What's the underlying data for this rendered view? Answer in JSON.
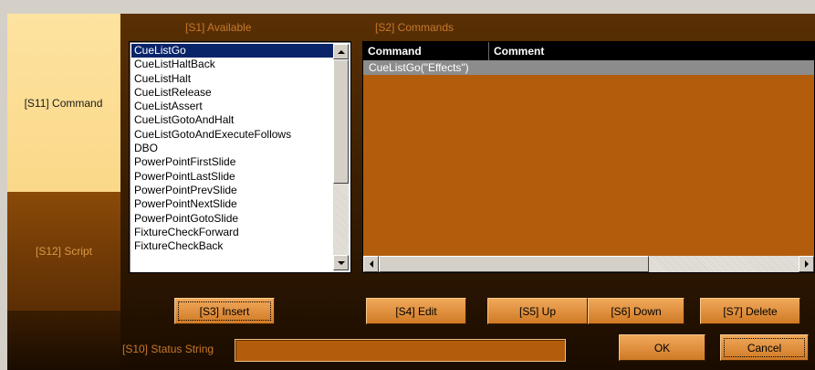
{
  "tabs": {
    "command": "[S11] Command",
    "script": "[S12] Script"
  },
  "labels": {
    "available": "[S1] Available",
    "commands": "[S2] Commands",
    "status": "[S10] Status String"
  },
  "available_list": {
    "selected_index": 0,
    "items": [
      "CueListGo",
      "CueListHaltBack",
      "CueListHalt",
      "CueListRelease",
      "CueListAssert",
      "CueListGotoAndHalt",
      "CueListGotoAndExecuteFollows",
      "DBO",
      "PowerPointFirstSlide",
      "PowerPointLastSlide",
      "PowerPointPrevSlide",
      "PowerPointNextSlide",
      "PowerPointGotoSlide",
      "FixtureCheckForward",
      "FixtureCheckBack"
    ]
  },
  "commands_grid": {
    "columns": [
      "Command",
      "Comment"
    ],
    "rows": [
      {
        "command": "CueListGo(\"Effects\")",
        "comment": ""
      }
    ]
  },
  "buttons": {
    "insert": "[S3] Insert",
    "edit": "[S4] Edit",
    "up": "[S5] Up",
    "down": "[S6] Down",
    "delete": "[S7] Delete",
    "ok": "OK",
    "cancel": "Cancel"
  },
  "status_string": "",
  "colors": {
    "accent_orange": "#b35d0c",
    "label_orange": "#c8772a",
    "active_tab": "#fde3a0"
  }
}
